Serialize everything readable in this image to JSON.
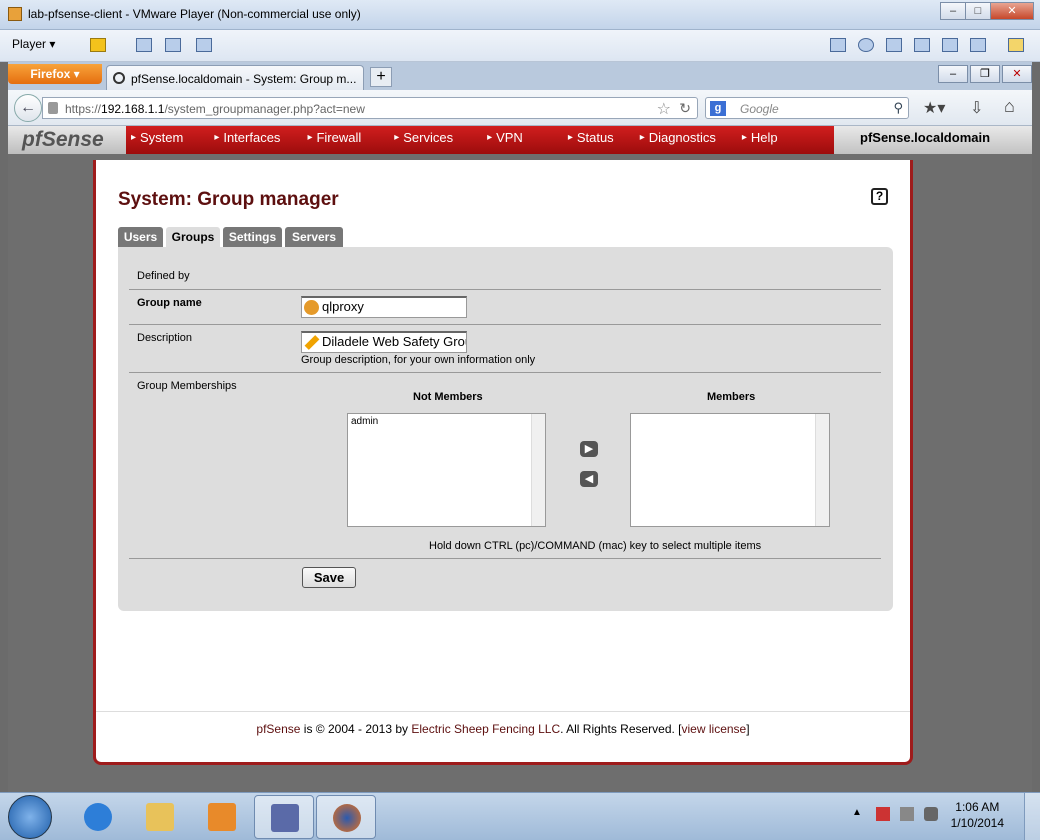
{
  "vm": {
    "title": "lab-pfsense-client - VMware Player (Non-commercial use only)",
    "player_label": "Player",
    "min": "–",
    "max": "□",
    "close": "✕"
  },
  "browser": {
    "menu_label": "Firefox ▾",
    "tab_title": "pfSense.localdomain - System: Group m...",
    "new_tab": "+",
    "url_prefix": "https://",
    "url_host": "192.168.1.1",
    "url_path": "/system_groupmanager.php?act=new",
    "search_engine": "g",
    "search_placeholder": "Google",
    "back_icon": "←"
  },
  "pf_nav": {
    "logo": "pfSense",
    "items": [
      "System",
      "Interfaces",
      "Firewall",
      "Services",
      "VPN",
      "Status",
      "Diagnostics",
      "Help"
    ],
    "hostname": "pfSense.localdomain"
  },
  "page": {
    "title": "System: Group manager",
    "help": "?",
    "tabs": [
      "Users",
      "Groups",
      "Settings",
      "Servers"
    ],
    "active_tab": "Groups"
  },
  "form": {
    "defined_by_label": "Defined by",
    "group_name_label": "Group name",
    "group_name_value": "qlproxy",
    "description_label": "Description",
    "description_value": "Diladele Web Safety Grou",
    "description_help": "Group description, for your own information only",
    "memberships_label": "Group Memberships",
    "not_members_label": "Not Members",
    "members_label": "Members",
    "not_members": [
      "admin"
    ],
    "members": [],
    "move_right": "▶",
    "move_left": "◀",
    "multi_select_help": "Hold down CTRL (pc)/COMMAND (mac) key to select multiple items",
    "save_label": "Save"
  },
  "footer": {
    "brand": "pfSense",
    "text1": " is © 2004 - 2013 by ",
    "company": "Electric Sheep Fencing LLC",
    "text2": ". All Rights Reserved. [",
    "license": "view license",
    "text3": "]"
  },
  "taskbar": {
    "time": "1:06 AM",
    "date": "1/10/2014"
  },
  "colors": {
    "accent": "#5d0f0f",
    "nav_red": "#b31515",
    "firefox_orange": "#f0881f"
  }
}
